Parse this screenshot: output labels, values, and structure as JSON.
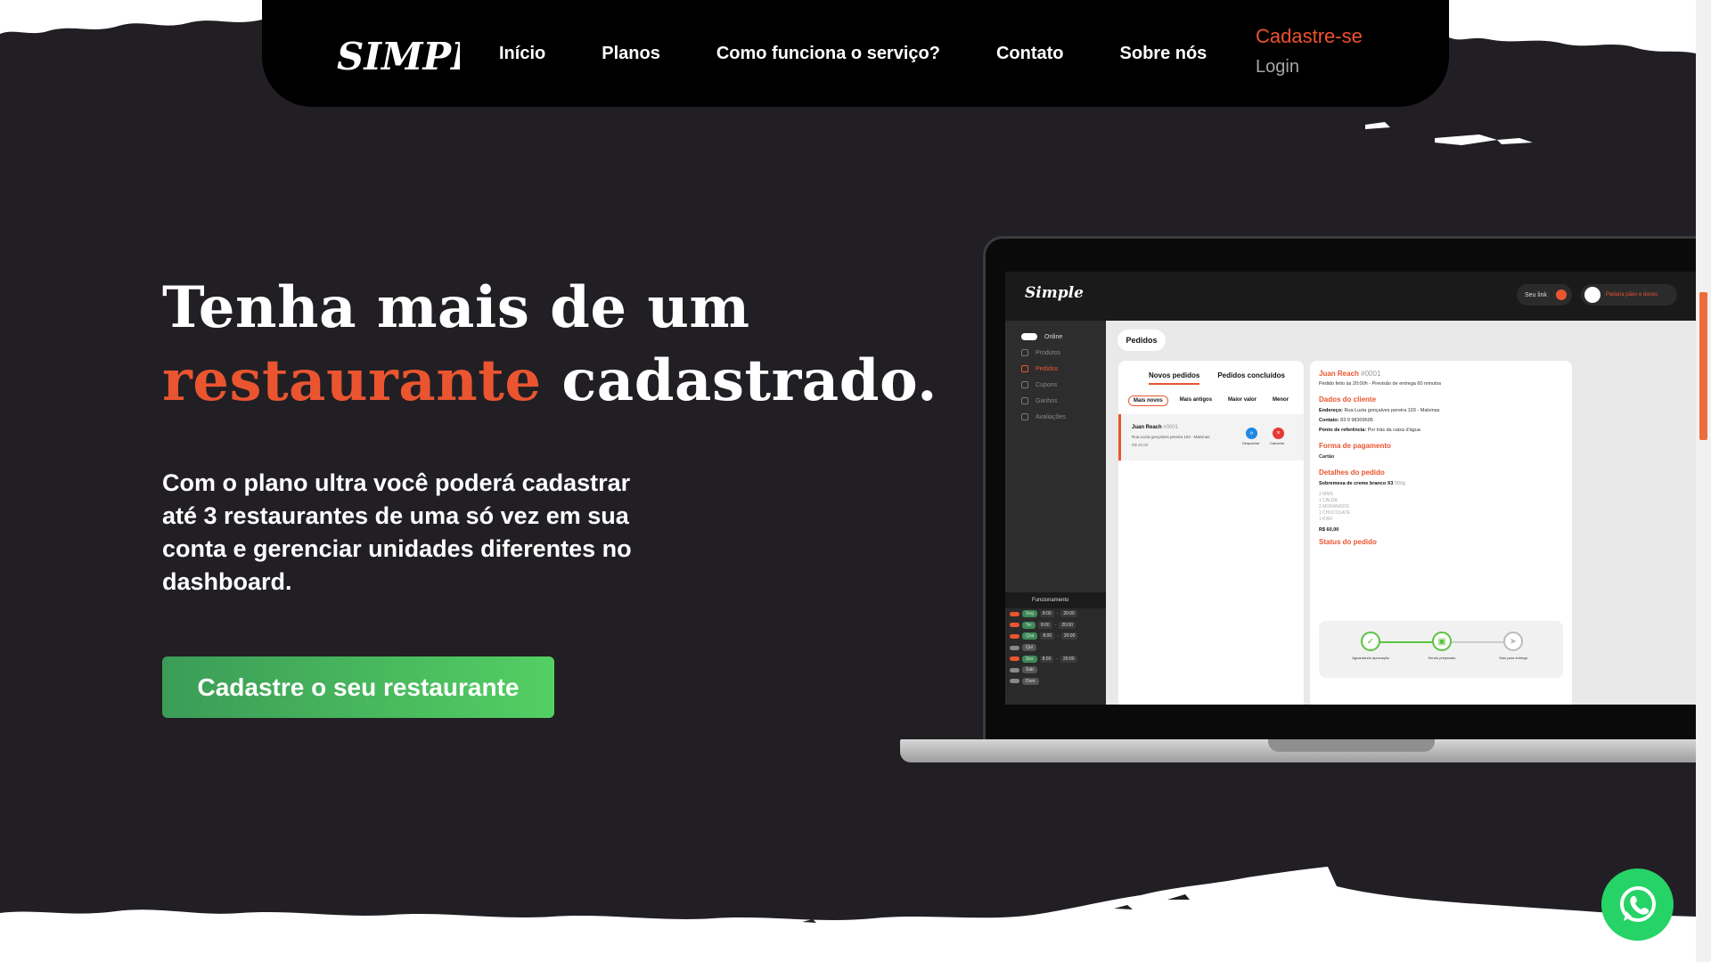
{
  "nav": {
    "links": [
      "Início",
      "Planos",
      "Como funciona o serviço?",
      "Contato",
      "Sobre nós"
    ],
    "signup_label": "Cadastre-se",
    "login_label": "Login",
    "logo_text": "SIMPLE"
  },
  "hero": {
    "title_line1": "Tenha mais de um",
    "title_accent": "restaurante",
    "title_rest": " cadastrado.",
    "description": "Com o plano ultra você poderá cadastrar até 3 restaurantes de uma só vez em sua conta e gerenciar unidades diferentes no dashboard.",
    "cta_label": "Cadastre o seu restaurante"
  },
  "dashboard": {
    "logo": "Simple",
    "seu_link": "Seu link",
    "store_name": "Padaria pães e doces",
    "sidebar": [
      "Online",
      "Produtos",
      "Pedidos",
      "Cupons",
      "Ganhos",
      "Avaliações"
    ],
    "funcionamento": "Funcionamento",
    "schedule": [
      {
        "day": "Seg",
        "on": true,
        "open": "8:00",
        "close": "20:00"
      },
      {
        "day": "Ter",
        "on": true,
        "open": "8:00",
        "close": "20:00"
      },
      {
        "day": "Qua",
        "on": true,
        "open": "8:00",
        "close": "20:00"
      },
      {
        "day": "Qui",
        "on": false,
        "open": "",
        "close": ""
      },
      {
        "day": "Sex",
        "on": true,
        "open": "8:00",
        "close": "20:00"
      },
      {
        "day": "Sab",
        "on": false,
        "open": "",
        "close": ""
      },
      {
        "day": "Dom",
        "on": false,
        "open": "",
        "close": ""
      }
    ],
    "pedidos_label": "Pedidos",
    "tab_new": "Novos pedidos",
    "tab_done": "Pedidos concluídos",
    "filters": [
      "Mais novos",
      "Mais antigos",
      "Maior valor",
      "Menor"
    ],
    "order": {
      "name": "Juan Reach",
      "number": "#0001",
      "address": "Rua Luzia gonçalves pereira 103 - Malvinas",
      "price": "R$ 20,00",
      "dispatch": "Despachar",
      "cancel": "Cancelar"
    },
    "detail": {
      "name": "Juan Reach",
      "number": "#0001",
      "placed": "Pedido feito às 20:00h - Previsão de entrega 60 minutos",
      "client_h": "Dados do cliente",
      "address_label": "Endereço:",
      "address": "Rua Luzia gonçalves pereira 103 - Malvinas",
      "contact_label": "Contato:",
      "contact": "83 9 98309605",
      "ref_label": "Ponto de referência:",
      "ref": "Por trás da caixa d'água",
      "payment_h": "Forma de pagamento",
      "payment": "Cartão",
      "details_h": "Detalhes do pedido",
      "item": "Sobremesa de creme branco  X3",
      "item_weight": "500g",
      "extras": [
        "2 MMS",
        "1 CALDA",
        "2 MORANGOS",
        "1 CHOCOLATE",
        "1 KIWI"
      ],
      "total": "R$ 60,00",
      "status_h": "Status do pedido",
      "steps": [
        "Aguardando aprovação",
        "Sendo preparado",
        "Saiu para entrega"
      ]
    }
  },
  "colors": {
    "background": "#221f24",
    "accent": "#ea5530",
    "cta_green": "#4cbb5e",
    "whatsapp": "#25d366"
  }
}
